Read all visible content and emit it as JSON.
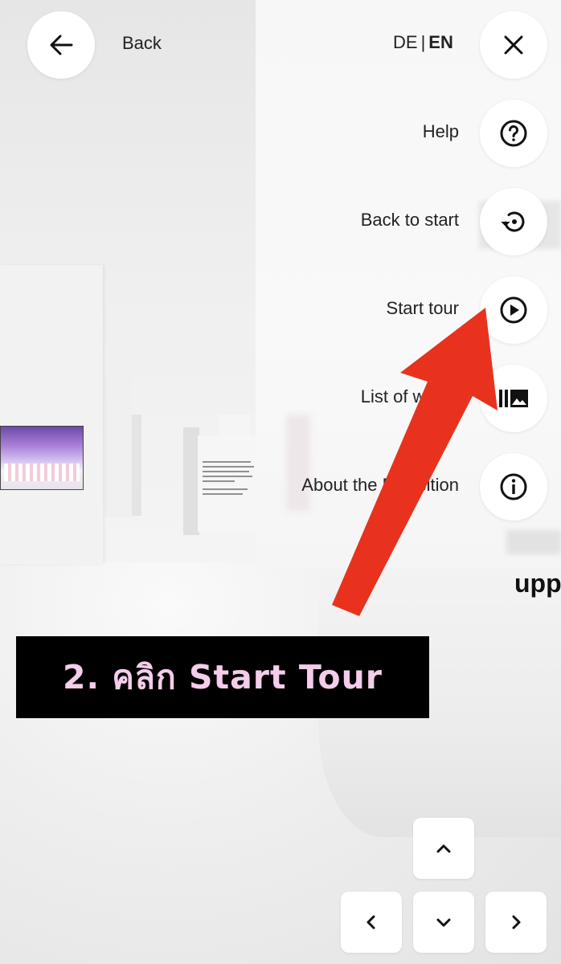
{
  "header": {
    "back_label": "Back",
    "lang_de": "DE",
    "lang_sep": "|",
    "lang_en": "EN"
  },
  "menu": {
    "items": [
      {
        "label": "Help",
        "icon": "help-icon"
      },
      {
        "label": "Back to start",
        "icon": "restart-icon"
      },
      {
        "label": "Start tour",
        "icon": "play-icon"
      },
      {
        "label": "List of works",
        "icon": "gallery-icon"
      },
      {
        "label": "About the Exhibition",
        "icon": "info-icon"
      }
    ],
    "close_icon": "close-icon"
  },
  "scene": {
    "wall_text": "upp"
  },
  "annotation": {
    "caption": "2. คลิก Start Tour",
    "caption_color": "#f3cdea",
    "arrow_color": "#e8321e"
  },
  "nav": {
    "keys": [
      "up-arrow",
      "left-arrow",
      "down-arrow",
      "right-arrow"
    ]
  }
}
